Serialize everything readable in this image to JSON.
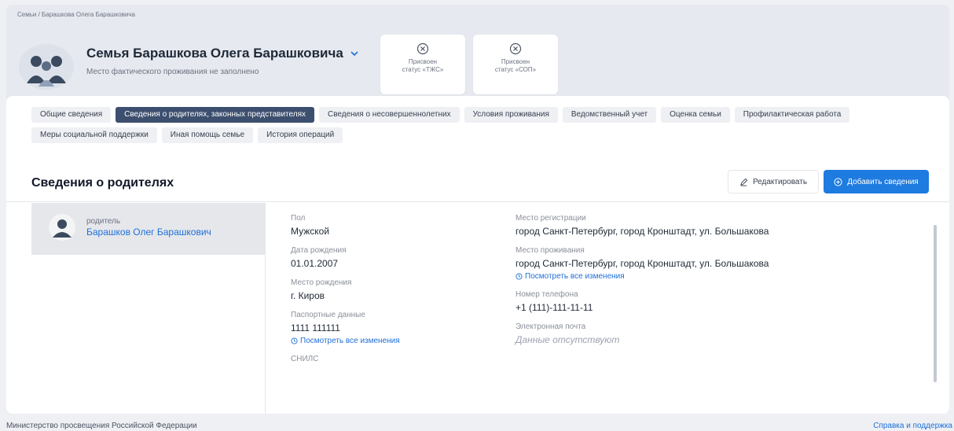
{
  "breadcrumb": "Семьи / Барашкова Олега Барашковича",
  "family": {
    "title": "Семья Барашкова Олега Барашковича",
    "subtitle": "Место фактического проживания не заполнено"
  },
  "statuses": [
    {
      "line1": "Присвоен",
      "line2": "статус «ТЖС»"
    },
    {
      "line1": "Присвоен",
      "line2": "статус «СОП»"
    }
  ],
  "tabs_row1": [
    {
      "label": "Общие сведения",
      "active": false
    },
    {
      "label": "Сведения о родителях, законных представителях",
      "active": true
    },
    {
      "label": "Сведения о несовершеннолетних",
      "active": false
    },
    {
      "label": "Условия проживания",
      "active": false
    },
    {
      "label": "Ведомственный учет",
      "active": false
    },
    {
      "label": "Оценка семьи",
      "active": false
    },
    {
      "label": "Профилактическая работа",
      "active": false
    }
  ],
  "tabs_row2": [
    {
      "label": "Меры социальной поддержки",
      "active": false
    },
    {
      "label": "Иная помощь семье",
      "active": false
    },
    {
      "label": "История операций",
      "active": false
    }
  ],
  "section": {
    "title": "Сведения о родителях",
    "edit_label": "Редактировать",
    "add_label": "Добавить сведения"
  },
  "parent": {
    "role": "родитель",
    "name": "Барашков Олег Барашкович"
  },
  "fields_left": {
    "gender_label": "Пол",
    "gender_value": "Мужской",
    "birthdate_label": "Дата рождения",
    "birthdate_value": "01.01.2007",
    "birthplace_label": "Место рождения",
    "birthplace_value": "г. Киров",
    "passport_label": "Паспортные данные",
    "passport_value": "1111 111111",
    "passport_history": "Посмотреть все изменения",
    "snils_label": "СНИЛС"
  },
  "fields_right": {
    "reg_label": "Место регистрации",
    "reg_value": "город Санкт-Петербург, город Кронштадт, ул. Большакова",
    "live_label": "Место проживания",
    "live_value": "город Санкт-Петербург, город Кронштадт, ул. Большакова",
    "live_history": "Посмотреть все изменения",
    "phone_label": "Номер телефона",
    "phone_value": "+1 (111)-111-11-11",
    "email_label": "Электронная почта",
    "email_value": "Данные отсутствуют"
  },
  "footer": {
    "left": "Министерство просвещения Российской Федерации",
    "right": "Справка и поддержка"
  },
  "colors": {
    "accent": "#1e7be0",
    "active_tab": "#3d4f6e",
    "link": "#1e6fd9"
  }
}
